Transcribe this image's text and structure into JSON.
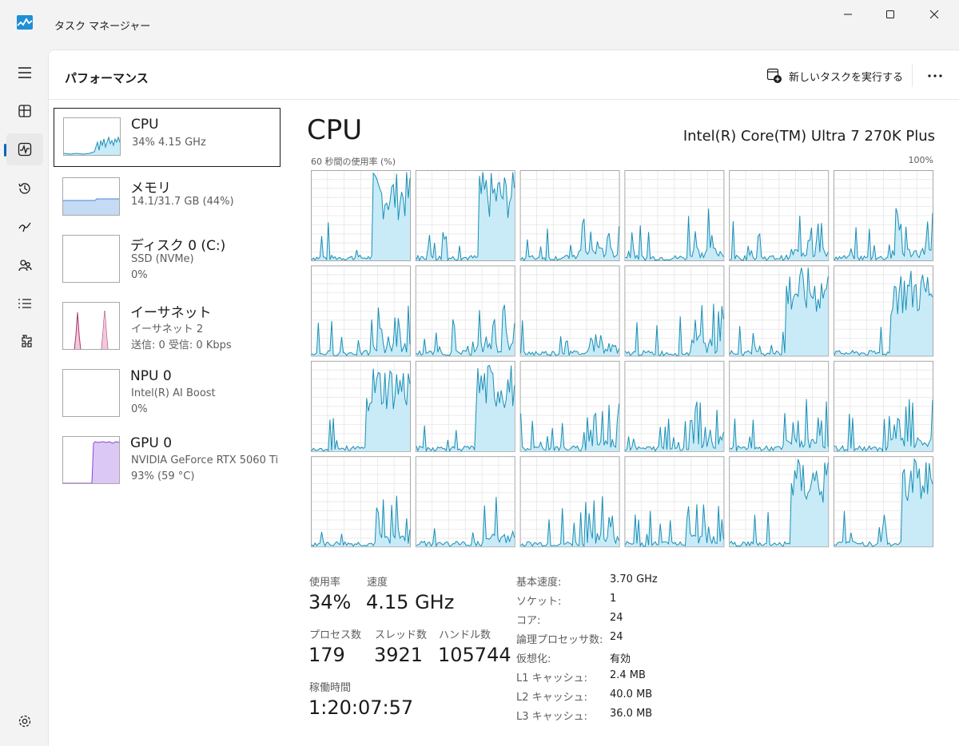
{
  "window": {
    "title": "タスク マネージャー"
  },
  "header": {
    "page_title": "パフォーマンス",
    "run_task_label": "新しいタスクを実行する"
  },
  "nav": {
    "items": [
      {
        "icon": "hamburger-menu-icon"
      },
      {
        "icon": "processes-icon"
      },
      {
        "icon": "performance-icon",
        "active": true
      },
      {
        "icon": "app-history-icon"
      },
      {
        "icon": "startup-apps-icon"
      },
      {
        "icon": "users-icon"
      },
      {
        "icon": "details-icon"
      },
      {
        "icon": "services-icon"
      },
      {
        "icon": "settings-icon"
      }
    ]
  },
  "devices": [
    {
      "name": "CPU",
      "line1": "34%  4.15 GHz",
      "line2": "",
      "selected": true
    },
    {
      "name": "メモリ",
      "line1": "14.1/31.7 GB (44%)",
      "line2": ""
    },
    {
      "name": "ディスク 0 (C:)",
      "line1": "SSD (NVMe)",
      "line2": "0%"
    },
    {
      "name": "イーサネット",
      "line1": "イーサネット 2",
      "line2": "送信: 0  受信: 0 Kbps"
    },
    {
      "name": "NPU 0",
      "line1": "Intel(R) AI Boost",
      "line2": "0%"
    },
    {
      "name": "GPU 0",
      "line1": "NVIDIA GeForce RTX 5060 Ti",
      "line2": "93%  (59 °C)"
    }
  ],
  "main": {
    "title": "CPU",
    "model": "Intel(R) Core(TM) Ultra 7 270K Plus",
    "axis_left": "60 秒間の使用率 (%)",
    "axis_right": "100%"
  },
  "stats": {
    "usage_label": "使用率",
    "usage_value": "34%",
    "speed_label": "速度",
    "speed_value": "4.15 GHz",
    "processes_label": "プロセス数",
    "processes_value": "179",
    "threads_label": "スレッド数",
    "threads_value": "3921",
    "handles_label": "ハンドル数",
    "handles_value": "105744",
    "uptime_label": "稼働時間",
    "uptime_value": "1:20:07:57"
  },
  "specs": [
    {
      "label": "基本速度:",
      "value": "3.70 GHz"
    },
    {
      "label": "ソケット:",
      "value": "1"
    },
    {
      "label": "コア:",
      "value": "24"
    },
    {
      "label": "論理プロセッサ数:",
      "value": "24"
    },
    {
      "label": "仮想化:",
      "value": "有効"
    },
    {
      "label": "L1 キャッシュ:",
      "value": "2.4 MB"
    },
    {
      "label": "L2 キャッシュ:",
      "value": "40.0 MB"
    },
    {
      "label": "L3 キャッシュ:",
      "value": "36.0 MB"
    }
  ],
  "colors": {
    "cpu_line": "#1a8fb6",
    "cpu_fill": "#c8ebf7",
    "memory_line": "#4a86d8",
    "memory_fill": "#c5daf4",
    "ethernet_line": "#b3326c",
    "gpu_line": "#8a44d8",
    "gpu_fill": "#dcc8f5",
    "grid": "#e6e6e6",
    "accent": "#0067c0"
  },
  "cpu_cores": {
    "count": 24,
    "columns": 6,
    "busy_core_indices": [
      0,
      1,
      10,
      11,
      12,
      13,
      22,
      23
    ]
  }
}
